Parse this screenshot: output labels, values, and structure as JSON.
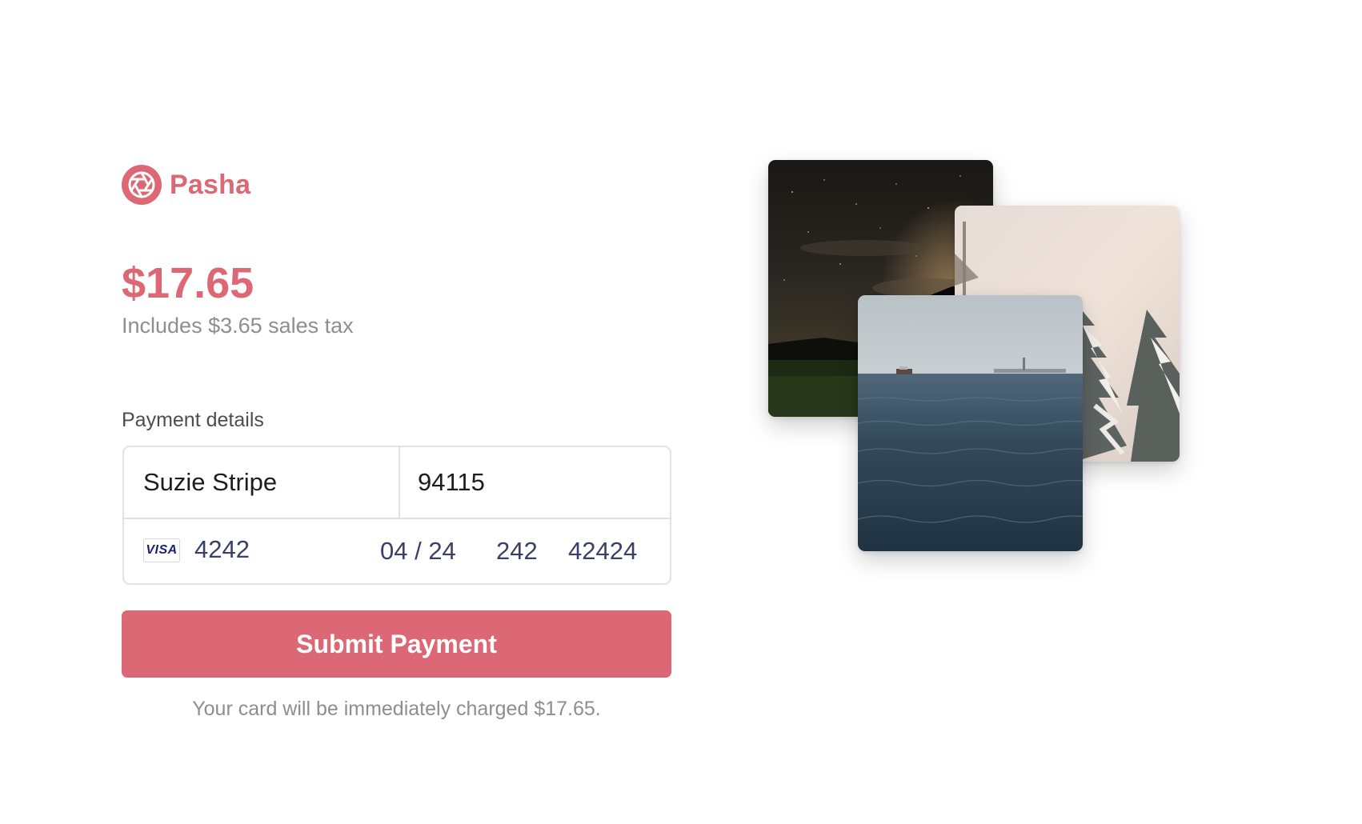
{
  "brand": {
    "name": "Pasha",
    "icon": "aperture-icon",
    "color": "#dc6875"
  },
  "order": {
    "amount": "$17.65",
    "tax_note": "Includes $3.65 sales tax"
  },
  "payment": {
    "section_label": "Payment details",
    "name_value": "Suzie Stripe",
    "zip_value": "94115",
    "card_brand": "VISA",
    "card_last4": "4242",
    "card_expiry": "04 / 24",
    "card_cvc": "242",
    "card_postal": "42424"
  },
  "actions": {
    "submit_label": "Submit Payment",
    "charge_note": "Your card will be immediately charged $17.65."
  },
  "photos": [
    {
      "name": "night-sky-photo"
    },
    {
      "name": "snowy-trees-photo"
    },
    {
      "name": "ocean-statue-photo"
    }
  ]
}
